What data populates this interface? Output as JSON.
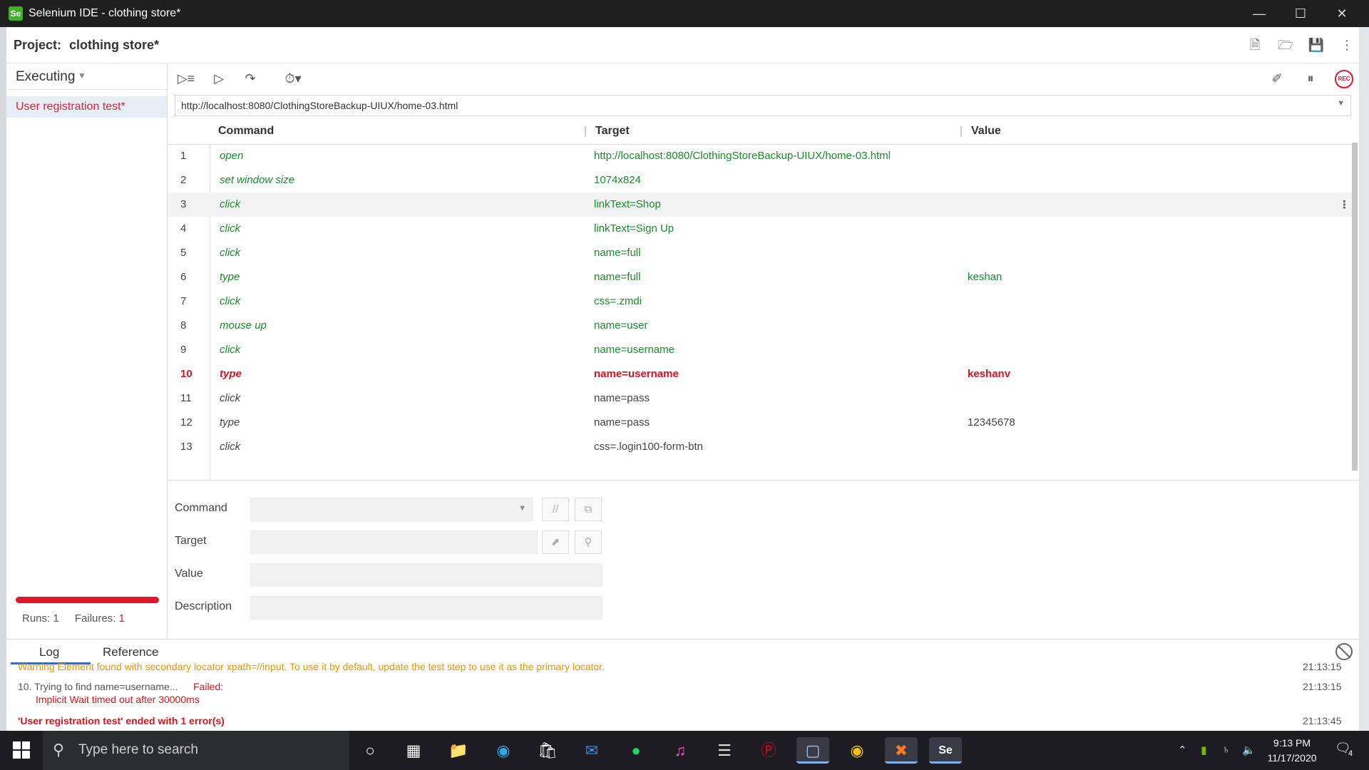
{
  "window": {
    "app_logo": "Se",
    "title": "Selenium IDE - clothing store*",
    "controls": [
      "minimize",
      "maximize",
      "close"
    ]
  },
  "project": {
    "label": "Project:",
    "name": "clothing store*",
    "icons": [
      "new-project-icon",
      "open-project-icon",
      "save-project-icon",
      "more-options-icon"
    ]
  },
  "sidebar": {
    "mode_label": "Executing",
    "tests": [
      {
        "name": "User registration test*",
        "selected": true,
        "color": "#e0203a"
      }
    ],
    "progress_fraction": 1.0,
    "runs_label": "Runs:",
    "runs_value": "1",
    "failures_label": "Failures:",
    "failures_value": "1"
  },
  "toolbar": {
    "left_icons": [
      "run-all-tests-icon",
      "run-current-test-icon",
      "step-over-icon",
      "test-execution-speed-icon"
    ],
    "right_icons": [
      "disable-breakpoints-icon",
      "pause-icon",
      "record-icon"
    ],
    "record_label": "REC"
  },
  "url": {
    "value": "http://localhost:8080/ClothingStoreBackup-UIUX/home-03.html"
  },
  "table": {
    "headers": {
      "command": "Command",
      "target": "Target",
      "value": "Value"
    },
    "rows": [
      {
        "num": "1",
        "command": "open",
        "target": "http://localhost:8080/ClothingStoreBackup-UIUX/home-03.html",
        "value": "",
        "status": "pass"
      },
      {
        "num": "2",
        "command": "set window size",
        "target": "1074x824",
        "value": "",
        "status": "pass"
      },
      {
        "num": "3",
        "command": "click",
        "target": "linkText=Shop",
        "value": "",
        "status": "pass"
      },
      {
        "num": "4",
        "command": "click",
        "target": "linkText=Sign Up",
        "value": "",
        "status": "pass"
      },
      {
        "num": "5",
        "command": "click",
        "target": "name=full",
        "value": "",
        "status": "pass"
      },
      {
        "num": "6",
        "command": "type",
        "target": "name=full",
        "value": "keshan",
        "status": "pass"
      },
      {
        "num": "7",
        "command": "click",
        "target": "css=.zmdi",
        "value": "",
        "status": "pass"
      },
      {
        "num": "8",
        "command": "mouse up",
        "target": "name=user",
        "value": "",
        "status": "pass"
      },
      {
        "num": "9",
        "command": "click",
        "target": "name=username",
        "value": "",
        "status": "pass"
      },
      {
        "num": "10",
        "command": "type",
        "target": "name=username",
        "value": "keshanv",
        "status": "fail"
      },
      {
        "num": "11",
        "command": "click",
        "target": "name=pass",
        "value": "",
        "status": "pend"
      },
      {
        "num": "12",
        "command": "type",
        "target": "name=pass",
        "value": "12345678",
        "status": "pend"
      },
      {
        "num": "13",
        "command": "click",
        "target": "css=.login100-form-btn",
        "value": "",
        "status": "pend"
      }
    ],
    "selected_row": 3,
    "row_menu_icon": "⋮"
  },
  "editor": {
    "command_label": "Command",
    "target_label": "Target",
    "value_label": "Value",
    "description_label": "Description",
    "command_value": "",
    "target_value": "",
    "value_value": "",
    "description_value": "",
    "comment_button": "//"
  },
  "log": {
    "tabs": [
      "Log",
      "Reference"
    ],
    "active_tab": "Log",
    "entries": [
      {
        "text": "Warning Element found with secondary locator xpath=//input. To use it by default, update the test step to use it as the primary locator.",
        "time": "21:13:15",
        "color": "#e59a00"
      },
      {
        "prefix": "10. Trying to find name=username...",
        "status": "Failed:",
        "detail": "Implicit Wait timed out after 30000ms",
        "time": "21:13:15"
      },
      {
        "text": "'User registration test' ended with 1 error(s)",
        "time": "21:13:45",
        "color": "#d8141e"
      }
    ]
  },
  "taskbar": {
    "search_placeholder": "Type here to search",
    "apps": [
      "cortana-icon",
      "task-view-icon",
      "file-explorer-icon",
      "edge-icon",
      "store-icon",
      "mail-icon",
      "spotify-icon",
      "itunes-icon",
      "stack-icon",
      "pinterest-icon",
      "virtualbox-icon",
      "chrome-icon",
      "xampp-icon",
      "selenium-ide-icon"
    ],
    "time": "9:13 PM",
    "date": "11/17/2020",
    "notification_count": "4"
  },
  "colors": {
    "pass": "#1d8a2d",
    "fail": "#d8141e",
    "accent": "#1b73e8",
    "selenium": "#43b02a"
  }
}
